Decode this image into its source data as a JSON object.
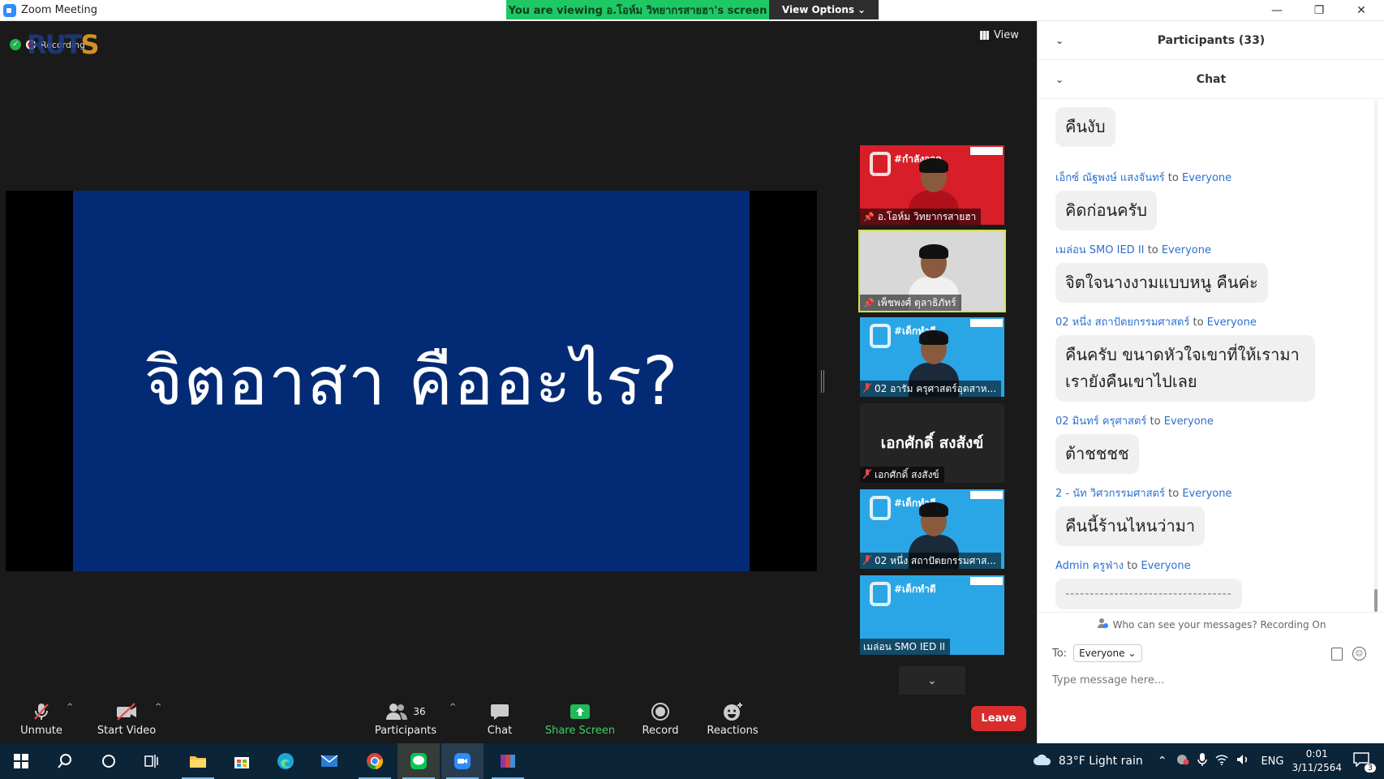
{
  "window": {
    "title": "Zoom Meeting"
  },
  "share_bar": {
    "text": "You are viewing อ.โอห์ม วิทยากรสายฮา's screen",
    "view_options": "View Options"
  },
  "top_overlay": {
    "recording_label": "Recording",
    "view_label": "View"
  },
  "slide": {
    "headline": "จิตอาสา คืออะไร?"
  },
  "gallery": [
    {
      "name": "อ.โอห์ม วิทยากรสายฮา",
      "badge_text": "#กำลังจวด",
      "background": "#d81e28",
      "pinned": true
    },
    {
      "name": "เพ็ชพงศ์ ตุลาธิภัทร์",
      "background": "#d8d8d8",
      "pinned": true,
      "active": true
    },
    {
      "name": "02 อารัม ครุศาสตร์อุตสาห...",
      "badge_text": "#เด็กทำดี",
      "background": "#2aa6e6",
      "muted": true
    },
    {
      "name": "เอกศักดิ์ สงสังข์",
      "big_name": "เอกศักดิ์ สงสังข์",
      "background": "#242424",
      "muted": true
    },
    {
      "name": "02 หนึ่ง สถาปัตยกรรมศาส...",
      "badge_text": "#เด็กทำดี",
      "background": "#2aa6e6",
      "muted": true
    },
    {
      "name": "เมล่อน SMO IED II",
      "badge_text": "#เด็กทำดี",
      "background": "#2aa6e6"
    }
  ],
  "toolbar": {
    "unmute": "Unmute",
    "start_video": "Start Video",
    "participants": "Participants",
    "participants_count": "36",
    "chat": "Chat",
    "share_screen": "Share Screen",
    "record": "Record",
    "reactions": "Reactions",
    "leave": "Leave"
  },
  "panel": {
    "participants_header": "Participants (33)",
    "chat_header": "Chat",
    "messages": [
      {
        "sender": "",
        "to": "",
        "recipient": "",
        "text": "คืนงับ"
      },
      {
        "sender": "เอ็กซ์ ณัฐพงษ์ แสงจันทร์",
        "to": "to",
        "recipient": "Everyone",
        "text": "คิดก่อนครับ"
      },
      {
        "sender": "เมล่อน SMO IED II",
        "to": "to",
        "recipient": "Everyone",
        "text": "จิตใจนางงามแบบหนู คืนค่ะ"
      },
      {
        "sender": "02 หนึ่ง สถาปัตยกรรมศาสตร์",
        "to": "to",
        "recipient": "Everyone",
        "text": "คืนครับ ขนาดหัวใจเขาที่ให้เรามา เรายังคืนเขาไปเลย"
      },
      {
        "sender": "02 มินทร์ ครุศาสตร์",
        "to": "to",
        "recipient": "Everyone",
        "text": "ต้าชชชช"
      },
      {
        "sender": "2 - นัท วิศวกรรมศาสตร์",
        "to": "to",
        "recipient": "Everyone",
        "text": "คืนนี้ร้านไหนว่ามา"
      },
      {
        "sender": "Admin ครูฟ่าง",
        "to": "to",
        "recipient": "Everyone",
        "text": "----------------------------------"
      }
    ],
    "who_can_see": "Who can see your messages? Recording On",
    "to_label": "To:",
    "to_value": "Everyone",
    "input_placeholder": "Type message here..."
  },
  "taskbar": {
    "weather": "83°F  Light rain",
    "language": "ENG",
    "time": "0:01",
    "date": "3/11/2564",
    "notifications": "3"
  }
}
